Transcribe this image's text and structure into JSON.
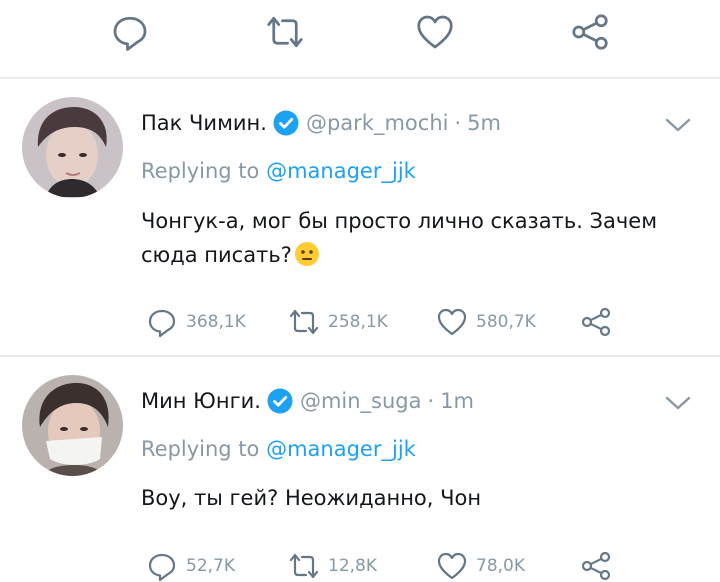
{
  "tweets": [
    {
      "name": "Пак Чимин.",
      "handle": "@park_mochi",
      "sep": "·",
      "time": "5m",
      "replying_prefix": "Replying to",
      "replying_to": "@manager_jjk",
      "text": "Чонгук-а, мог бы просто лично сказать. Зачем сюда писать?",
      "emoji": "neutral-face",
      "replies": "368,1K",
      "retweets": "258,1K",
      "likes": "580,7K"
    },
    {
      "name": "Мин Юнги.",
      "handle": "@min_suga",
      "sep": "·",
      "time": "1m",
      "replying_prefix": "Replying to",
      "replying_to": "@manager_jjk",
      "text": "Воу, ты гей? Неожиданно, Чон",
      "replies": "52,7K",
      "retweets": "12,8K",
      "likes": "78,0K"
    }
  ],
  "colors": {
    "text": "#14171a",
    "muted": "#8899a6",
    "link": "#1da1f2",
    "icon": "#657786",
    "divider": "#e9ecef"
  },
  "icons": [
    "reply-icon",
    "retweet-icon",
    "like-icon",
    "share-icon",
    "verified-badge-icon",
    "chevron-down-icon"
  ]
}
